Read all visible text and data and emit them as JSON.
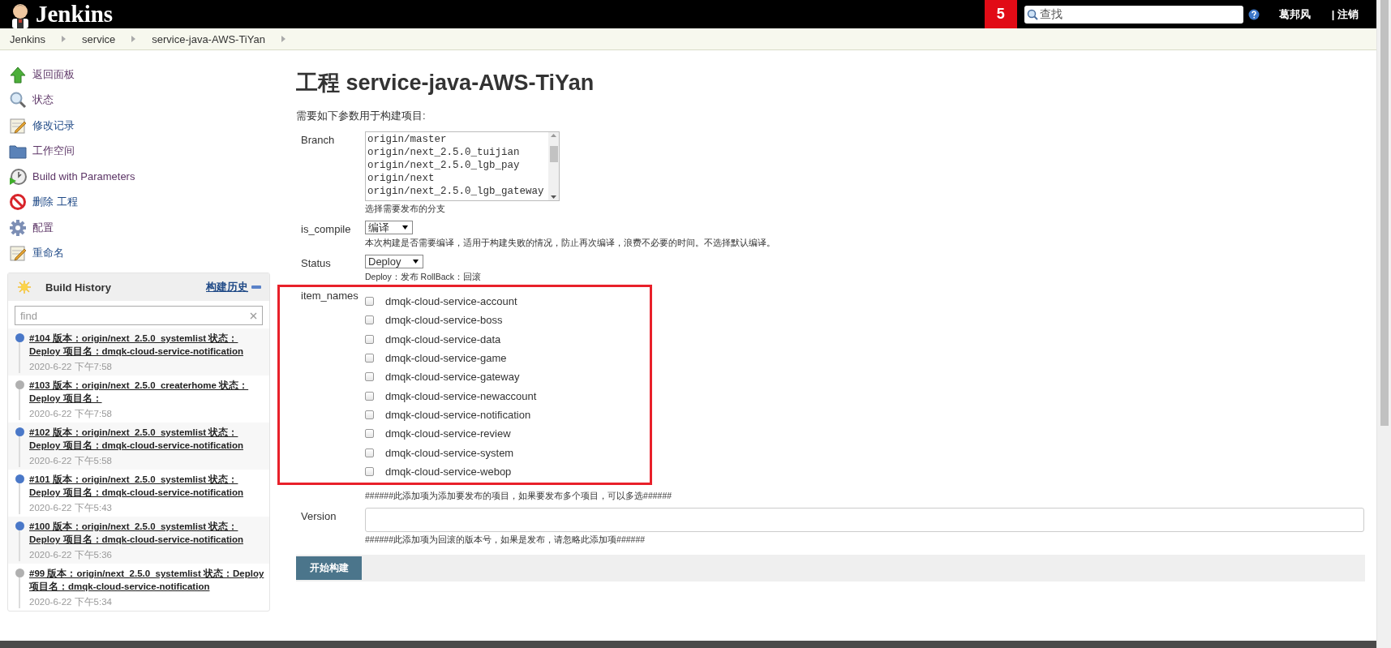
{
  "header": {
    "logo_text": "Jenkins",
    "badge": "5",
    "search": {
      "placeholder": "查找"
    },
    "user": "葛邦风",
    "logout": "| 注销"
  },
  "breadcrumb": [
    "Jenkins",
    "service",
    "service-java-AWS-TiYan"
  ],
  "sidebar": {
    "items": [
      {
        "label": "返回面板",
        "visited": true
      },
      {
        "label": "状态",
        "visited": true
      },
      {
        "label": "修改记录",
        "visited": false
      },
      {
        "label": "工作空间",
        "visited": true
      },
      {
        "label": "Build with Parameters",
        "visited": true
      },
      {
        "label": "删除 工程",
        "visited": false
      },
      {
        "label": "配置",
        "visited": true
      },
      {
        "label": "重命名",
        "visited": false
      }
    ]
  },
  "build_history": {
    "title": "Build History",
    "link": "构建历史",
    "filter": {
      "placeholder": "find"
    },
    "builds": [
      {
        "title": "#104 版本：origin/next_2.5.0_systemlist 状态：Deploy 项目名：dmqk-cloud-service-notification",
        "time": "2020-6-22 下午7:58",
        "color": "#4a78c8"
      },
      {
        "title": "#103 版本：origin/next_2.5.0_createrhome 状态：Deploy 项目名：",
        "time": "2020-6-22 下午7:58",
        "color": "#b0b0b0"
      },
      {
        "title": "#102 版本：origin/next_2.5.0_systemlist 状态：Deploy 项目名：dmqk-cloud-service-notification",
        "time": "2020-6-22 下午5:58",
        "color": "#4a78c8"
      },
      {
        "title": "#101 版本：origin/next_2.5.0_systemlist 状态：Deploy 项目名：dmqk-cloud-service-notification",
        "time": "2020-6-22 下午5:43",
        "color": "#4a78c8"
      },
      {
        "title": "#100 版本：origin/next_2.5.0_systemlist 状态：Deploy 项目名：dmqk-cloud-service-notification",
        "time": "2020-6-22 下午5:36",
        "color": "#4a78c8"
      },
      {
        "title": "#99 版本：origin/next_2.5.0_systemlist 状态：Deploy 项目名：dmqk-cloud-service-notification",
        "time": "2020-6-22 下午5:34",
        "color": "#b0b0b0"
      }
    ]
  },
  "main": {
    "title": "工程 service-java-AWS-TiYan",
    "intro": "需要如下参数用于构建项目:",
    "params": [
      {
        "kind": "listbox",
        "label": "Branch",
        "options": [
          {
            "label": "origin/master",
            "selected": false
          },
          {
            "label": "origin/next_2.5.0_tuijian",
            "selected": false
          },
          {
            "label": "origin/next_2.5.0_lgb_pay",
            "selected": false
          },
          {
            "label": "origin/next",
            "selected": false
          },
          {
            "label": "origin/next_2.5.0_lgb_gateway",
            "selected": false
          }
        ],
        "hint": "选择需要发布的分支",
        "highlighted": false
      },
      {
        "kind": "select",
        "label": "is_compile",
        "value": "编译",
        "hint": "本次构建是否需要编译，适用于构建失败的情况，防止再次编译，浪费不必要的时间。不选择默认编译。",
        "highlighted": false
      },
      {
        "kind": "select",
        "label": "Status",
        "value": "Deploy",
        "hint": "Deploy：发布 RollBack：回滚",
        "highlighted": false
      },
      {
        "kind": "checkboxes",
        "label": "item_names",
        "items": [
          {
            "label": "dmqk-cloud-service-account",
            "checked": false
          },
          {
            "label": "dmqk-cloud-service-boss",
            "checked": false
          },
          {
            "label": "dmqk-cloud-service-data",
            "checked": false
          },
          {
            "label": "dmqk-cloud-service-game",
            "checked": false
          },
          {
            "label": "dmqk-cloud-service-gateway",
            "checked": false
          },
          {
            "label": "dmqk-cloud-service-newaccount",
            "checked": false
          },
          {
            "label": "dmqk-cloud-service-notification",
            "checked": false
          },
          {
            "label": "dmqk-cloud-service-review",
            "checked": false
          },
          {
            "label": "dmqk-cloud-service-system",
            "checked": false
          },
          {
            "label": "dmqk-cloud-service-webop",
            "checked": false
          }
        ],
        "hint": "######此添加项为添加要发布的项目，如果要发布多个项目，可以多选######",
        "highlighted": true
      },
      {
        "kind": "text",
        "label": "Version",
        "hint": "######此添加项为回滚的版本号，如果是发布，请忽略此添加项######",
        "highlighted": false
      }
    ],
    "submit": "开始构建"
  }
}
